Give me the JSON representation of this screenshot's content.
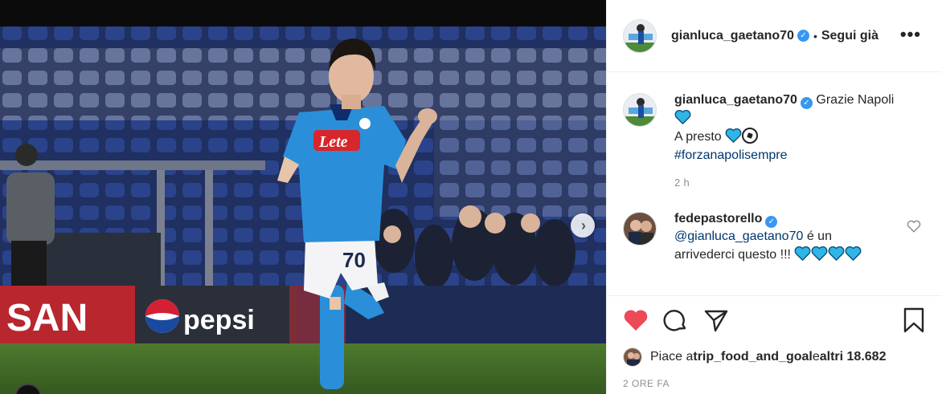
{
  "photo": {
    "jersey_sponsor": "Lete",
    "jersey_number": "70",
    "ad_board_left": "SAN",
    "ad_board_right": "pepsi"
  },
  "header": {
    "username": "gianluca_gaetano70",
    "separator": "•",
    "follow_label": "Segui già",
    "more_label": "•••"
  },
  "caption": {
    "username": "gianluca_gaetano70",
    "line1": "Grazie Napoli",
    "line2": "A presto",
    "hashtag": "#forzanapolisempre",
    "time": "2 h"
  },
  "comment": {
    "username": "fedepastorello",
    "mention": "@gianluca_gaetano70",
    "text_after_mention": " é un",
    "line2": "arrivederci questo !!! "
  },
  "likes": {
    "prefix": "Piace a ",
    "user": "trip_food_and_goal",
    "middle": " e ",
    "others": "altri 18.682"
  },
  "post_date": "2 ORE FA",
  "colors": {
    "like_red": "#ed4956",
    "verified_blue": "#3897f0",
    "heart_blue": "#2fb5e8",
    "napoli_blue": "#2a8fd8"
  }
}
